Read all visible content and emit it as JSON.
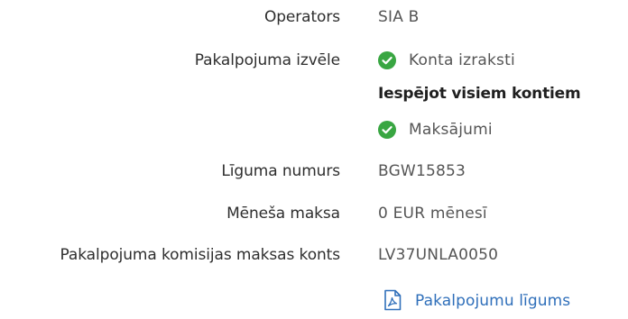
{
  "details": {
    "operator": {
      "label": "Operators",
      "value": "SIA B"
    },
    "service_choice": {
      "label": "Pakalpojuma izvēle",
      "options": [
        {
          "text": "Konta izraksti",
          "icon": "check-circle-icon",
          "note": "Iespējot visiem kontiem"
        },
        {
          "text": "Maksājumi",
          "icon": "check-circle-icon"
        }
      ]
    },
    "contract_number": {
      "label": "Līguma numurs",
      "value": "BGW15853"
    },
    "monthly_fee": {
      "label": "Mēneša maksa",
      "value": "0 EUR mēnesī"
    },
    "fee_account": {
      "label": "Pakalpojuma komisijas maksas konts",
      "value": "LV37UNLA0050"
    },
    "agreement_link": {
      "text": "Pakalpojumu līgums",
      "icon": "pdf-document-icon"
    }
  },
  "colors": {
    "check": "#39a642",
    "link": "#2f6fba"
  }
}
